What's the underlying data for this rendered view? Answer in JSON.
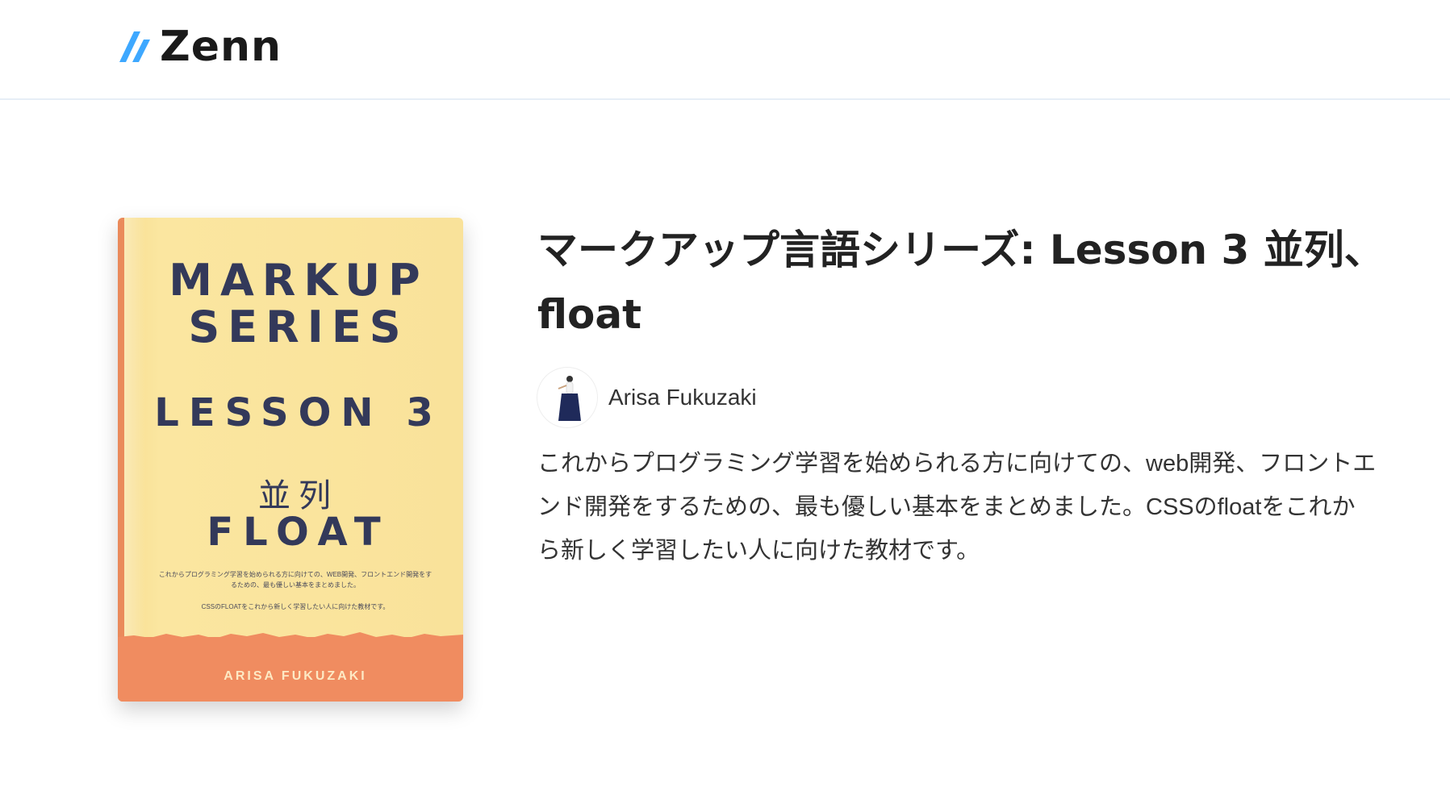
{
  "header": {
    "logo_text": "Zenn",
    "logo_icon": "zenn-logo-icon",
    "brand_color": "#3ea8ff"
  },
  "book": {
    "cover": {
      "title_line1": "MARKUP",
      "title_line2": "SERIES",
      "lesson": "LESSON 3",
      "kanji": "並列",
      "subtitle": "FLOAT",
      "desc_line1": "これからプログラミング学習を始められる方に向けての、WEB開発、フロントエンド開発をするための、最も優しい基本をまとめました。",
      "desc_line2": "CSSのFLOATをこれから新しく学習したい人に向けた教材です。",
      "author": "ARISA FUKUZAKI",
      "colors": {
        "background": "#f9e29a",
        "text": "#33395a",
        "accent": "#f08c60"
      }
    },
    "title": "マークアップ言語シリーズ: Lesson 3 並列、float",
    "author_name": "Arisa Fukuzaki",
    "description": "これからプログラミング学習を始められる方に向けての、web開発、フロントエンド開発をするための、最も優しい基本をまとめました。CSSのfloatをこれから新しく学習したい人に向けた教材です。"
  }
}
